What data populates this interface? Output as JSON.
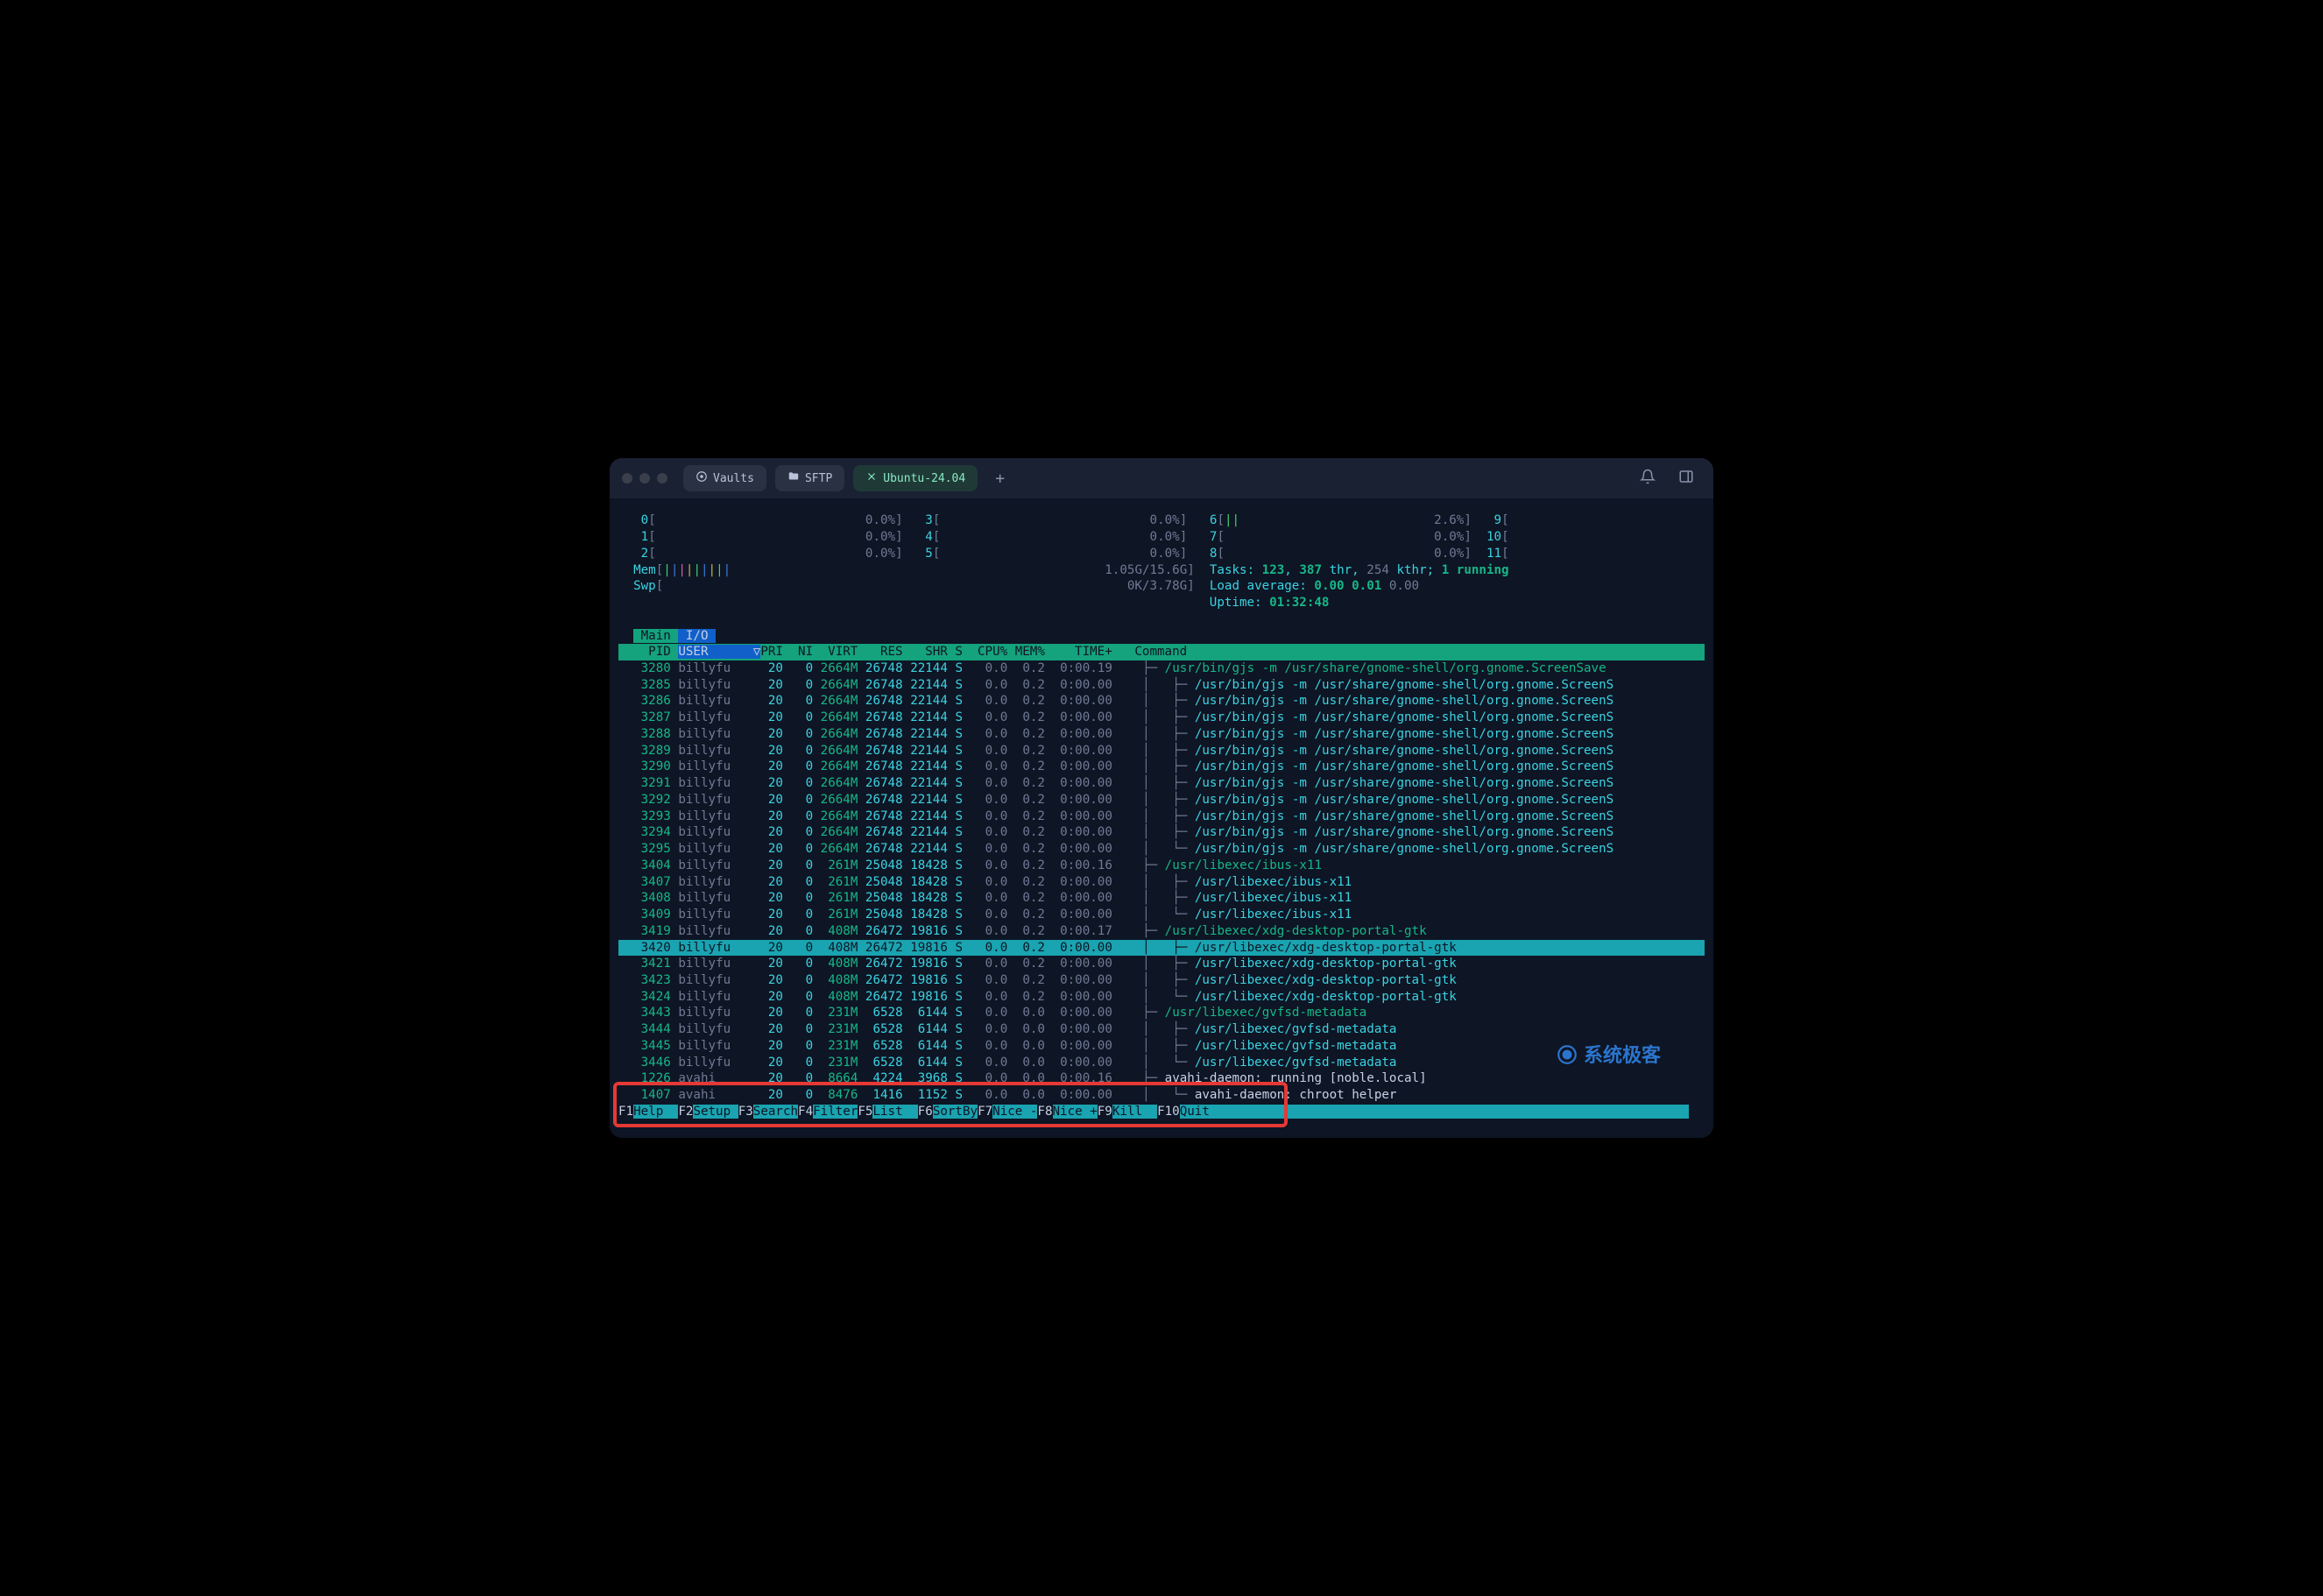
{
  "titlebar": {
    "pills": [
      {
        "icon": "vault",
        "label": "Vaults"
      },
      {
        "icon": "folder",
        "label": "SFTP"
      },
      {
        "icon": "close",
        "label": "Ubuntu-24.04",
        "active": true
      }
    ]
  },
  "cpu": {
    "cols": [
      [
        {
          "n": "0",
          "v": "0.0%"
        },
        {
          "n": "1",
          "v": "0.0%"
        },
        {
          "n": "2",
          "v": "0.0%"
        }
      ],
      [
        {
          "n": "3",
          "v": "0.0%"
        },
        {
          "n": "4",
          "v": "0.0%"
        },
        {
          "n": "5",
          "v": "0.0%"
        }
      ],
      [
        {
          "n": "6",
          "v": "2.6%",
          "bar": "||"
        },
        {
          "n": "7",
          "v": "0.0%"
        },
        {
          "n": "8",
          "v": "0.0%"
        }
      ],
      [
        {
          "n": "9",
          "v": "0.0%"
        },
        {
          "n": "10",
          "v": "0.0%"
        },
        {
          "n": "11",
          "v": "0.0%"
        }
      ]
    ]
  },
  "mem": {
    "label": "Mem",
    "bar": "|||||||||",
    "text": "1.05G/15.6G"
  },
  "swp": {
    "label": "Swp",
    "bar": "",
    "text": "0K/3.78G"
  },
  "tasks": {
    "label": "Tasks:",
    "total": "123",
    "thr": "387",
    "kthr": "254",
    "running": "1 running",
    "sep1": "thr,",
    "sep2": "kthr;"
  },
  "load": {
    "label": "Load average:",
    "v1": "0.00",
    "v2": "0.01",
    "v3": "0.00"
  },
  "uptime": {
    "label": "Uptime:",
    "value": "01:32:48"
  },
  "tabs": {
    "main": "Main",
    "io": "I/O"
  },
  "columns": [
    "PID",
    "USER",
    "PRI",
    "NI",
    "VIRT",
    "RES",
    "SHR",
    "S",
    "CPU%",
    "MEM%",
    "TIME+",
    "Command"
  ],
  "sort_indicator": "▽",
  "tree": {
    "branch": "├─ ",
    "last": "└─ ",
    "pipe": "│  "
  },
  "cmd": {
    "gjs_full": "/usr/bin/gjs -m /usr/share/gnome-shell/org.gnome.ScreenSave",
    "gjs": "/usr/bin/gjs -m /usr/share/gnome-shell/org.gnome.ScreenS",
    "ibus": "/usr/libexec/ibus-x11",
    "xdg": "/usr/libexec/xdg-desktop-portal-gtk",
    "gvfs": "/usr/libexec/gvfsd-metadata",
    "avahi_run": "avahi-daemon: running [noble.local]",
    "avahi_chroot": "avahi-daemon: chroot helper"
  },
  "rows": [
    {
      "pid": "3280",
      "user": "billyfu",
      "pri": "20",
      "ni": "0",
      "virt": "2664M",
      "res": "26748",
      "shr": "22144",
      "s": "S",
      "cpu": "0.0",
      "mem": "0.2",
      "time": "0:00.19",
      "tree": "root",
      "cmd": "gjs_full"
    },
    {
      "pid": "3285",
      "user": "billyfu",
      "pri": "20",
      "ni": "0",
      "virt": "2664M",
      "res": "26748",
      "shr": "22144",
      "s": "S",
      "cpu": "0.0",
      "mem": "0.2",
      "time": "0:00.00",
      "tree": "branch",
      "cmd": "gjs"
    },
    {
      "pid": "3286",
      "user": "billyfu",
      "pri": "20",
      "ni": "0",
      "virt": "2664M",
      "res": "26748",
      "shr": "22144",
      "s": "S",
      "cpu": "0.0",
      "mem": "0.2",
      "time": "0:00.00",
      "tree": "branch",
      "cmd": "gjs"
    },
    {
      "pid": "3287",
      "user": "billyfu",
      "pri": "20",
      "ni": "0",
      "virt": "2664M",
      "res": "26748",
      "shr": "22144",
      "s": "S",
      "cpu": "0.0",
      "mem": "0.2",
      "time": "0:00.00",
      "tree": "branch",
      "cmd": "gjs"
    },
    {
      "pid": "3288",
      "user": "billyfu",
      "pri": "20",
      "ni": "0",
      "virt": "2664M",
      "res": "26748",
      "shr": "22144",
      "s": "S",
      "cpu": "0.0",
      "mem": "0.2",
      "time": "0:00.00",
      "tree": "branch",
      "cmd": "gjs"
    },
    {
      "pid": "3289",
      "user": "billyfu",
      "pri": "20",
      "ni": "0",
      "virt": "2664M",
      "res": "26748",
      "shr": "22144",
      "s": "S",
      "cpu": "0.0",
      "mem": "0.2",
      "time": "0:00.00",
      "tree": "branch",
      "cmd": "gjs"
    },
    {
      "pid": "3290",
      "user": "billyfu",
      "pri": "20",
      "ni": "0",
      "virt": "2664M",
      "res": "26748",
      "shr": "22144",
      "s": "S",
      "cpu": "0.0",
      "mem": "0.2",
      "time": "0:00.00",
      "tree": "branch",
      "cmd": "gjs"
    },
    {
      "pid": "3291",
      "user": "billyfu",
      "pri": "20",
      "ni": "0",
      "virt": "2664M",
      "res": "26748",
      "shr": "22144",
      "s": "S",
      "cpu": "0.0",
      "mem": "0.2",
      "time": "0:00.00",
      "tree": "branch",
      "cmd": "gjs"
    },
    {
      "pid": "3292",
      "user": "billyfu",
      "pri": "20",
      "ni": "0",
      "virt": "2664M",
      "res": "26748",
      "shr": "22144",
      "s": "S",
      "cpu": "0.0",
      "mem": "0.2",
      "time": "0:00.00",
      "tree": "branch",
      "cmd": "gjs"
    },
    {
      "pid": "3293",
      "user": "billyfu",
      "pri": "20",
      "ni": "0",
      "virt": "2664M",
      "res": "26748",
      "shr": "22144",
      "s": "S",
      "cpu": "0.0",
      "mem": "0.2",
      "time": "0:00.00",
      "tree": "branch",
      "cmd": "gjs"
    },
    {
      "pid": "3294",
      "user": "billyfu",
      "pri": "20",
      "ni": "0",
      "virt": "2664M",
      "res": "26748",
      "shr": "22144",
      "s": "S",
      "cpu": "0.0",
      "mem": "0.2",
      "time": "0:00.00",
      "tree": "branch",
      "cmd": "gjs"
    },
    {
      "pid": "3295",
      "user": "billyfu",
      "pri": "20",
      "ni": "0",
      "virt": "2664M",
      "res": "26748",
      "shr": "22144",
      "s": "S",
      "cpu": "0.0",
      "mem": "0.2",
      "time": "0:00.00",
      "tree": "last",
      "cmd": "gjs"
    },
    {
      "pid": "3404",
      "user": "billyfu",
      "pri": "20",
      "ni": "0",
      "virt": "261M",
      "res": "25048",
      "shr": "18428",
      "s": "S",
      "cpu": "0.0",
      "mem": "0.2",
      "time": "0:00.16",
      "tree": "root",
      "cmd": "ibus"
    },
    {
      "pid": "3407",
      "user": "billyfu",
      "pri": "20",
      "ni": "0",
      "virt": "261M",
      "res": "25048",
      "shr": "18428",
      "s": "S",
      "cpu": "0.0",
      "mem": "0.2",
      "time": "0:00.00",
      "tree": "branch",
      "cmd": "ibus"
    },
    {
      "pid": "3408",
      "user": "billyfu",
      "pri": "20",
      "ni": "0",
      "virt": "261M",
      "res": "25048",
      "shr": "18428",
      "s": "S",
      "cpu": "0.0",
      "mem": "0.2",
      "time": "0:00.00",
      "tree": "branch",
      "cmd": "ibus"
    },
    {
      "pid": "3409",
      "user": "billyfu",
      "pri": "20",
      "ni": "0",
      "virt": "261M",
      "res": "25048",
      "shr": "18428",
      "s": "S",
      "cpu": "0.0",
      "mem": "0.2",
      "time": "0:00.00",
      "tree": "last",
      "cmd": "ibus"
    },
    {
      "pid": "3419",
      "user": "billyfu",
      "pri": "20",
      "ni": "0",
      "virt": "408M",
      "res": "26472",
      "shr": "19816",
      "s": "S",
      "cpu": "0.0",
      "mem": "0.2",
      "time": "0:00.17",
      "tree": "root",
      "cmd": "xdg"
    },
    {
      "pid": "3420",
      "user": "billyfu",
      "pri": "20",
      "ni": "0",
      "virt": "408M",
      "res": "26472",
      "shr": "19816",
      "s": "S",
      "cpu": "0.0",
      "mem": "0.2",
      "time": "0:00.00",
      "tree": "branch",
      "cmd": "xdg",
      "selected": true
    },
    {
      "pid": "3421",
      "user": "billyfu",
      "pri": "20",
      "ni": "0",
      "virt": "408M",
      "res": "26472",
      "shr": "19816",
      "s": "S",
      "cpu": "0.0",
      "mem": "0.2",
      "time": "0:00.00",
      "tree": "branch",
      "cmd": "xdg"
    },
    {
      "pid": "3423",
      "user": "billyfu",
      "pri": "20",
      "ni": "0",
      "virt": "408M",
      "res": "26472",
      "shr": "19816",
      "s": "S",
      "cpu": "0.0",
      "mem": "0.2",
      "time": "0:00.00",
      "tree": "branch",
      "cmd": "xdg"
    },
    {
      "pid": "3424",
      "user": "billyfu",
      "pri": "20",
      "ni": "0",
      "virt": "408M",
      "res": "26472",
      "shr": "19816",
      "s": "S",
      "cpu": "0.0",
      "mem": "0.2",
      "time": "0:00.00",
      "tree": "last",
      "cmd": "xdg"
    },
    {
      "pid": "3443",
      "user": "billyfu",
      "pri": "20",
      "ni": "0",
      "virt": "231M",
      "res": "6528",
      "shr": "6144",
      "s": "S",
      "cpu": "0.0",
      "mem": "0.0",
      "time": "0:00.00",
      "tree": "root",
      "cmd": "gvfs"
    },
    {
      "pid": "3444",
      "user": "billyfu",
      "pri": "20",
      "ni": "0",
      "virt": "231M",
      "res": "6528",
      "shr": "6144",
      "s": "S",
      "cpu": "0.0",
      "mem": "0.0",
      "time": "0:00.00",
      "tree": "branch",
      "cmd": "gvfs"
    },
    {
      "pid": "3445",
      "user": "billyfu",
      "pri": "20",
      "ni": "0",
      "virt": "231M",
      "res": "6528",
      "shr": "6144",
      "s": "S",
      "cpu": "0.0",
      "mem": "0.0",
      "time": "0:00.00",
      "tree": "branch",
      "cmd": "gvfs"
    },
    {
      "pid": "3446",
      "user": "billyfu",
      "pri": "20",
      "ni": "0",
      "virt": "231M",
      "res": "6528",
      "shr": "6144",
      "s": "S",
      "cpu": "0.0",
      "mem": "0.0",
      "time": "0:00.00",
      "tree": "last",
      "cmd": "gvfs"
    },
    {
      "pid": "1226",
      "user": "avahi",
      "pri": "20",
      "ni": "0",
      "virt": "8664",
      "res": "4224",
      "shr": "3968",
      "s": "S",
      "cpu": "0.0",
      "mem": "0.0",
      "time": "0:00.16",
      "tree": "avroot",
      "cmd": "avahi_run"
    },
    {
      "pid": "1407",
      "user": "avahi",
      "pri": "20",
      "ni": "0",
      "virt": "8476",
      "res": "1416",
      "shr": "1152",
      "s": "S",
      "cpu": "0.0",
      "mem": "0.0",
      "time": "0:00.00",
      "tree": "avchild",
      "cmd": "avahi_chroot"
    }
  ],
  "fkeys": [
    {
      "n": "F1",
      "l": "Help  "
    },
    {
      "n": "F2",
      "l": "Setup "
    },
    {
      "n": "F3",
      "l": "Search"
    },
    {
      "n": "F4",
      "l": "Filter"
    },
    {
      "n": "F5",
      "l": "List  "
    },
    {
      "n": "F6",
      "l": "SortBy"
    },
    {
      "n": "F7",
      "l": "Nice -"
    },
    {
      "n": "F8",
      "l": "Nice +"
    },
    {
      "n": "F9",
      "l": "Kill  "
    },
    {
      "n": "F10",
      "l": "Quit  "
    }
  ],
  "watermark": "系统极客"
}
